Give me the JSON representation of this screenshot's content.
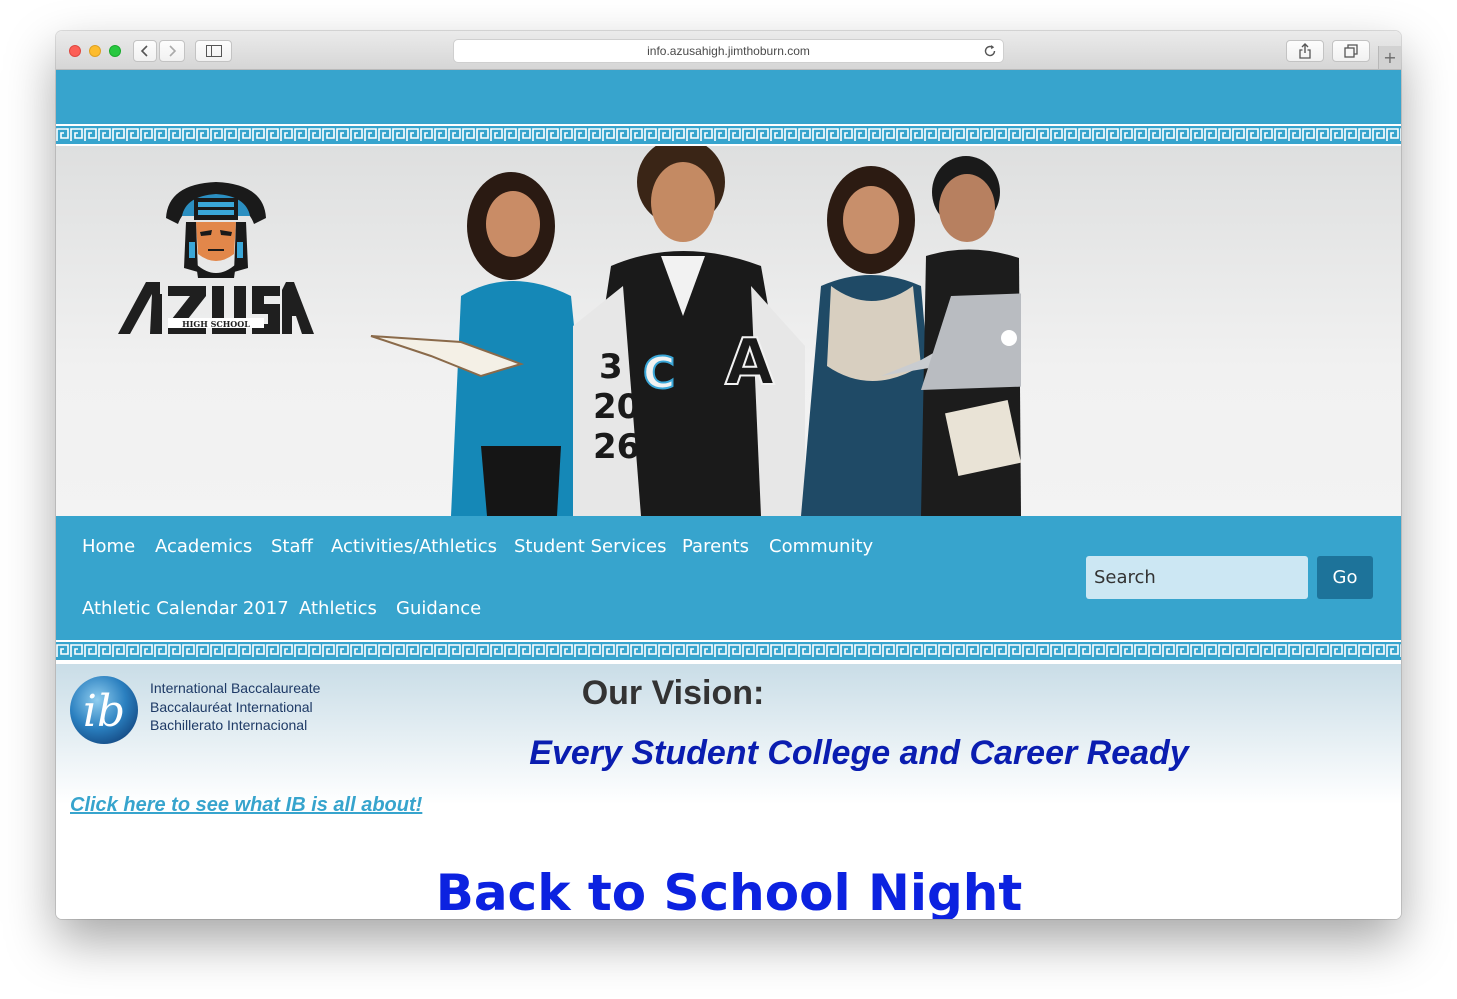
{
  "browser": {
    "url": "info.azusahigh.jimthoburn.com"
  },
  "logo": {
    "name": "AZUSA",
    "subtitle": "HIGH SCHOOL"
  },
  "nav": {
    "items": [
      {
        "label": "Home"
      },
      {
        "label": "Academics"
      },
      {
        "label": "Staff"
      },
      {
        "label": "Activities/Athletics"
      },
      {
        "label": "Student Services"
      },
      {
        "label": "Parents"
      },
      {
        "label": "Community"
      },
      {
        "label": "Athletic Calendar 2017"
      },
      {
        "label": "Athletics"
      },
      {
        "label": "Guidance"
      }
    ],
    "search_placeholder": "Search",
    "go_label": "Go"
  },
  "ib": {
    "lines": [
      "International Baccalaureate",
      "Baccalauréat International",
      "Bachillerato Internacional"
    ],
    "link_text": "Click here to see what IB is all about!"
  },
  "vision": {
    "title": "Our Vision:",
    "tagline": "Every Student College and Career Ready"
  },
  "headline": "Back to School Night",
  "colors": {
    "brand_blue": "#37a4cd",
    "go_button": "#1d739a",
    "tagline": "#0a1db0",
    "headline": "#0c22e0"
  },
  "icons": {
    "hero_students": "students-photo",
    "logo_mascot": "aztec-warrior-icon"
  }
}
